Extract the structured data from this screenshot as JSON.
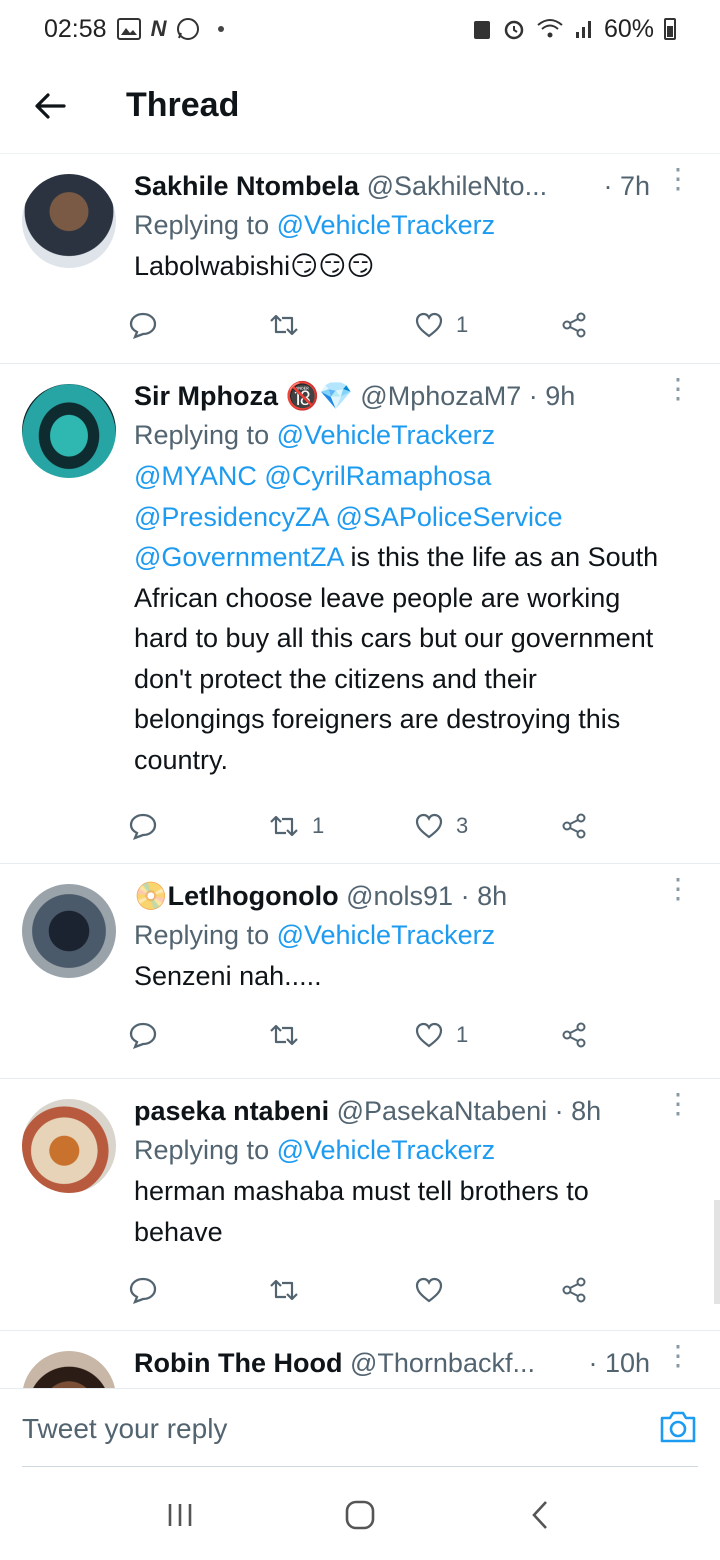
{
  "status_bar": {
    "time": "02:58",
    "battery": "60%"
  },
  "header": {
    "title": "Thread"
  },
  "tweets": [
    {
      "name": "Sakhile Ntombela",
      "handle": "@SakhileNto...",
      "time": "· 7h",
      "replying_prefix": "Replying to ",
      "replying_to": "@VehicleTrackerz",
      "text": "Labolwabishi😏😏😏",
      "reply_count": "",
      "retweet_count": "",
      "like_count": "1"
    },
    {
      "name": "Sir Mphoza",
      "badges": "🔞💎",
      "handle": "@MphozaM7",
      "time": "· 9h",
      "replying_prefix": "Replying to ",
      "replying_to": "@VehicleTrackerz",
      "mentions_line1": "@MYANC @CyrilRamaphosa",
      "mentions_line2": "@PresidencyZA @SAPoliceService",
      "mentions_line3": "@GovernmentZA",
      "text": " is this the life as an South African  choose leave people are working hard to buy all this cars but our government don't protect the citizens and their belongings foreigners are destroying this country.",
      "reply_count": "",
      "retweet_count": "1",
      "like_count": "3"
    },
    {
      "name": "Letlhogonolo",
      "name_prefix": "📀",
      "handle": "@nols91",
      "time": "· 8h",
      "replying_prefix": "Replying to ",
      "replying_to": "@VehicleTrackerz",
      "text": "Senzeni nah.....",
      "reply_count": "",
      "retweet_count": "",
      "like_count": "1"
    },
    {
      "name": "paseka ntabeni",
      "handle": "@PasekaNtabeni",
      "time": "· 8h",
      "replying_prefix": "Replying to ",
      "replying_to": "@VehicleTrackerz",
      "text": "herman mashaba must tell brothers to behave",
      "reply_count": "",
      "retweet_count": "",
      "like_count": ""
    },
    {
      "name": "Robin The Hood",
      "handle": "@Thornbackf...",
      "time": "· 10h"
    }
  ],
  "composer": {
    "placeholder": "Tweet your reply"
  },
  "icons": {
    "accent": "#1d9bf0",
    "muted": "#536471"
  }
}
